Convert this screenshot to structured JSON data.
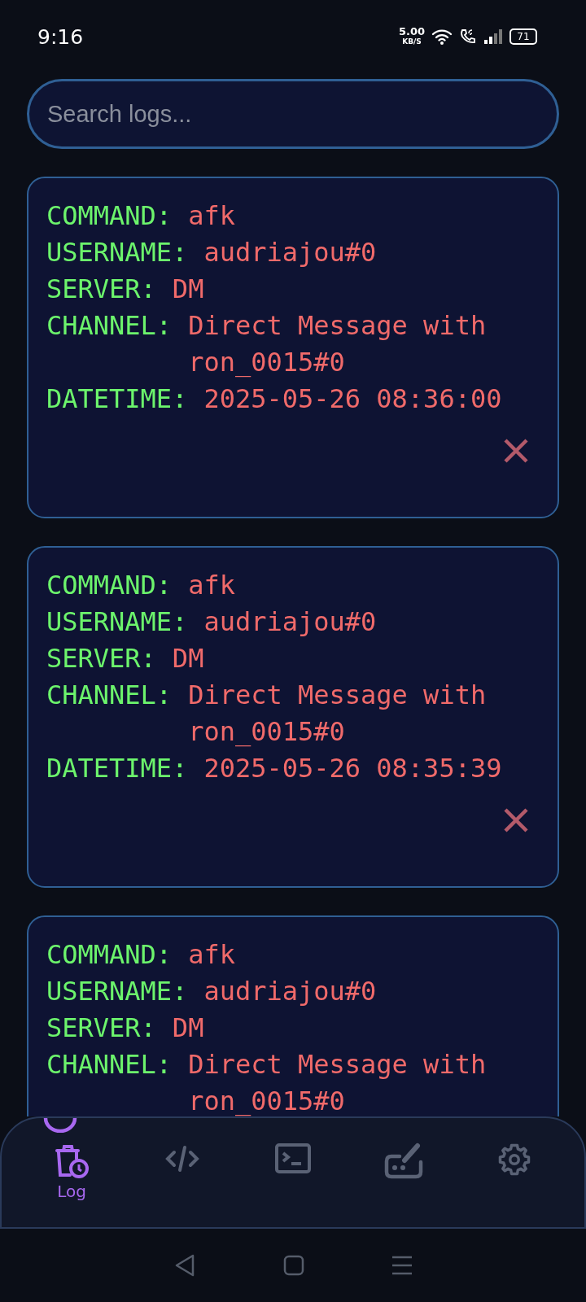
{
  "status_bar": {
    "time": "9:16",
    "net_speed": "5.00",
    "net_unit": "KB/S",
    "battery": "71"
  },
  "search": {
    "placeholder": "Search logs..."
  },
  "logs": [
    {
      "fields": [
        {
          "label": "COMMAND:",
          "value": "afk"
        },
        {
          "label": "USERNAME:",
          "value": "audriajou#0"
        },
        {
          "label": "SERVER:",
          "value": "DM"
        },
        {
          "label": "CHANNEL:",
          "value": "Direct Message with ron_0015#0"
        },
        {
          "label": "DATETIME:",
          "value": "2025-05-26 08:36:00"
        }
      ]
    },
    {
      "fields": [
        {
          "label": "COMMAND:",
          "value": "afk"
        },
        {
          "label": "USERNAME:",
          "value": "audriajou#0"
        },
        {
          "label": "SERVER:",
          "value": "DM"
        },
        {
          "label": "CHANNEL:",
          "value": "Direct Message with ron_0015#0"
        },
        {
          "label": "DATETIME:",
          "value": "2025-05-26 08:35:39"
        }
      ]
    },
    {
      "fields": [
        {
          "label": "COMMAND:",
          "value": "afk"
        },
        {
          "label": "USERNAME:",
          "value": "audriajou#0"
        },
        {
          "label": "SERVER:",
          "value": "DM"
        },
        {
          "label": "CHANNEL:",
          "value": "Direct Message with ron_0015#0"
        }
      ]
    }
  ],
  "bottom_nav": [
    {
      "label": "Log",
      "selected": true
    },
    {
      "selected": false
    },
    {
      "selected": false
    },
    {
      "selected": false
    },
    {
      "selected": false
    }
  ]
}
